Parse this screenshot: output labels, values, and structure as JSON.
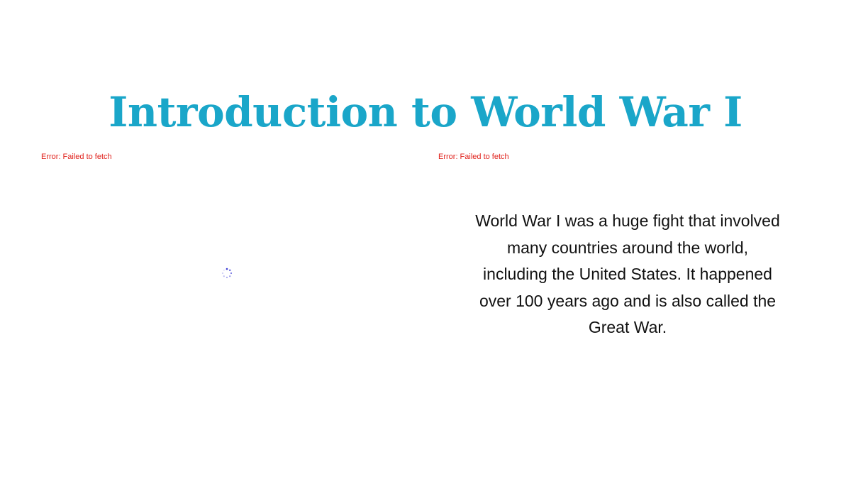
{
  "slide": {
    "title": "Introduction to World War I",
    "errors": {
      "left": "Error: Failed to fetch",
      "right": "Error: Failed to fetch"
    },
    "loading_icon": "loading-spinner-icon",
    "body": "World War I was a huge fight that involved many countries around the world, including the United States. It happened over 100 years ago and is also called the Great War."
  },
  "colors": {
    "title": "#1aa6c9",
    "error": "#e0211b",
    "spinner": "#3b3bd6",
    "body_text": "#111111",
    "background": "#ffffff"
  }
}
